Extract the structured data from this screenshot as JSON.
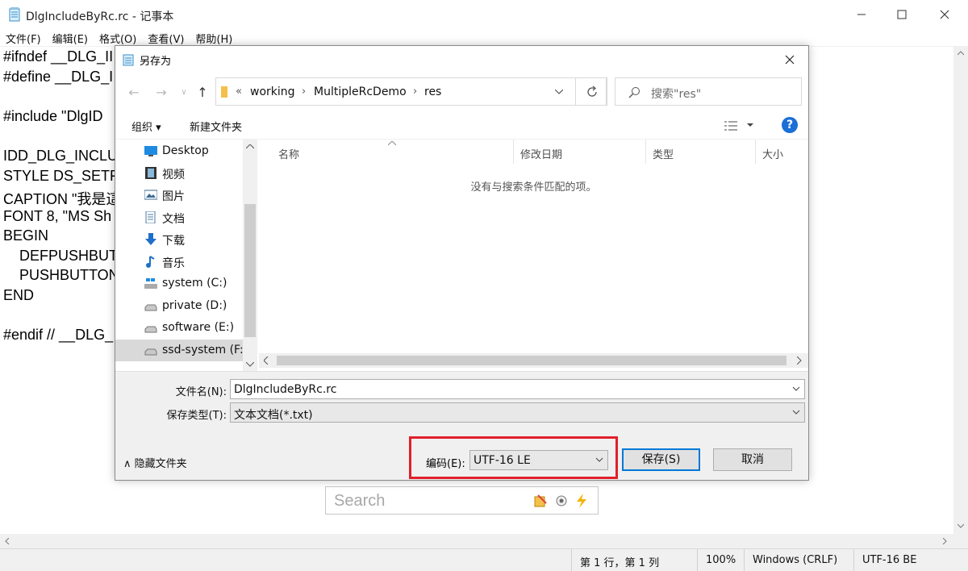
{
  "notepad": {
    "title": "DlgIncludeByRc.rc - 记事本",
    "menu": [
      "文件(F)",
      "编辑(E)",
      "格式(O)",
      "查看(V)",
      "帮助(H)"
    ],
    "lines": [
      "#ifndef __DLG_II",
      "#define __DLG_I",
      "",
      "#include \"DlgID",
      "",
      "IDD_DLG_INCLU",
      "STYLE DS_SETFC",
      "CAPTION \"我是這",
      "FONT 8, \"MS Sh",
      "BEGIN",
      "    DEFPUSHBUT",
      "    PUSHBUTTON",
      "END",
      "",
      "#endif // __DLG_"
    ],
    "status": {
      "position": "第 1 行，第 1 列",
      "zoom": "100%",
      "line_ending": "Windows (CRLF)",
      "encoding": "UTF-16 BE"
    }
  },
  "background_search": {
    "placeholder": "Search"
  },
  "dialog": {
    "title": "另存为",
    "address": {
      "overflow": "«",
      "parts": [
        "working",
        "MultipleRcDemo",
        "res"
      ]
    },
    "search_placeholder": "搜索\"res\"",
    "toolbar": {
      "organize": "组织 ▾",
      "new_folder": "新建文件夹"
    },
    "tree": [
      {
        "label": "Desktop",
        "icon": "desktop-icon"
      },
      {
        "label": "视频",
        "icon": "video-icon"
      },
      {
        "label": "图片",
        "icon": "pictures-icon"
      },
      {
        "label": "文档",
        "icon": "documents-icon"
      },
      {
        "label": "下载",
        "icon": "download-icon"
      },
      {
        "label": "音乐",
        "icon": "music-icon"
      },
      {
        "label": "system (C:)",
        "icon": "windows-drive-icon"
      },
      {
        "label": "private (D:)",
        "icon": "drive-icon"
      },
      {
        "label": "software (E:)",
        "icon": "drive-icon"
      },
      {
        "label": "ssd-system (F:)",
        "icon": "drive-icon",
        "selected": true
      }
    ],
    "columns": [
      "名称",
      "修改日期",
      "类型",
      "大小"
    ],
    "empty_message": "没有与搜索条件匹配的项。",
    "filename_label": "文件名(N):",
    "filename_value": "DlgIncludeByRc.rc",
    "filetype_label": "保存类型(T):",
    "filetype_value": "文本文档(*.txt)",
    "hide_folders": "隐藏文件夹",
    "encoding_label": "编码(E):",
    "encoding_value": "UTF-16 LE",
    "save_button": "保存(S)",
    "cancel_button": "取消",
    "colors": {
      "highlight_border": "#e0202a",
      "primary_border": "#0078d7",
      "help": "#1a6fd6"
    }
  }
}
